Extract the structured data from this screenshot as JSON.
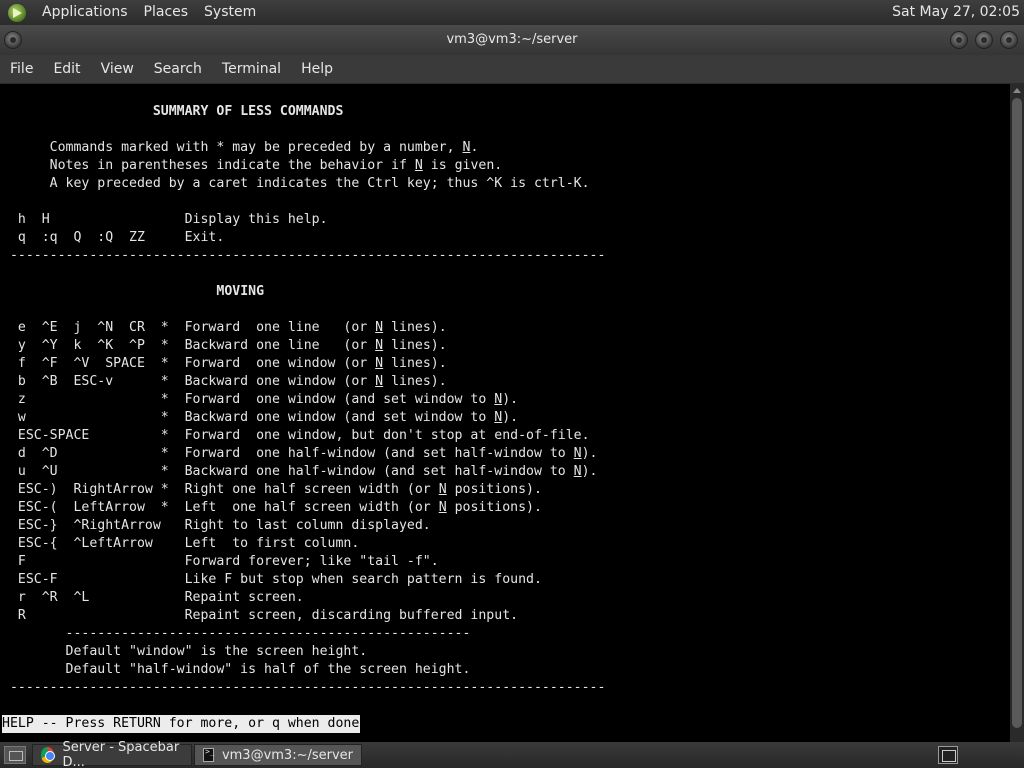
{
  "top_panel": {
    "menus": [
      "Applications",
      "Places",
      "System"
    ],
    "clock": "Sat May 27, 02:05"
  },
  "window": {
    "title": "vm3@vm3:~/server",
    "menubar": [
      "File",
      "Edit",
      "View",
      "Search",
      "Terminal",
      "Help"
    ]
  },
  "terminal": {
    "lines": [
      [
        {
          "t": "                   "
        },
        {
          "t": "SUMMARY OF LESS COMMANDS",
          "b": true
        }
      ],
      [],
      [
        {
          "t": "      Commands marked with * may be preceded by a number, "
        },
        {
          "t": "N",
          "u": true
        },
        {
          "t": "."
        }
      ],
      [
        {
          "t": "      Notes in parentheses indicate the behavior if "
        },
        {
          "t": "N",
          "u": true
        },
        {
          "t": " is given."
        }
      ],
      [
        {
          "t": "      A key preceded by a caret indicates the Ctrl key; thus ^K is ctrl-K."
        }
      ],
      [],
      [
        {
          "t": "  h  H                 Display this help."
        }
      ],
      [
        {
          "t": "  q  :q  Q  :Q  ZZ     Exit."
        }
      ],
      [
        {
          "t": " ---------------------------------------------------------------------------"
        }
      ],
      [],
      [
        {
          "t": "                           "
        },
        {
          "t": "MOVING",
          "b": true
        }
      ],
      [],
      [
        {
          "t": "  e  ^E  j  ^N  CR  *  Forward  one line   (or "
        },
        {
          "t": "N",
          "u": true
        },
        {
          "t": " lines)."
        }
      ],
      [
        {
          "t": "  y  ^Y  k  ^K  ^P  *  Backward one line   (or "
        },
        {
          "t": "N",
          "u": true
        },
        {
          "t": " lines)."
        }
      ],
      [
        {
          "t": "  f  ^F  ^V  SPACE  *  Forward  one window (or "
        },
        {
          "t": "N",
          "u": true
        },
        {
          "t": " lines)."
        }
      ],
      [
        {
          "t": "  b  ^B  ESC-v      *  Backward one window (or "
        },
        {
          "t": "N",
          "u": true
        },
        {
          "t": " lines)."
        }
      ],
      [
        {
          "t": "  z                 *  Forward  one window (and set window to "
        },
        {
          "t": "N",
          "u": true
        },
        {
          "t": ")."
        }
      ],
      [
        {
          "t": "  w                 *  Backward one window (and set window to "
        },
        {
          "t": "N",
          "u": true
        },
        {
          "t": ")."
        }
      ],
      [
        {
          "t": "  ESC-SPACE         *  Forward  one window, but don't stop at end-of-file."
        }
      ],
      [
        {
          "t": "  d  ^D             *  Forward  one half-window (and set half-window to "
        },
        {
          "t": "N",
          "u": true
        },
        {
          "t": ")."
        }
      ],
      [
        {
          "t": "  u  ^U             *  Backward one half-window (and set half-window to "
        },
        {
          "t": "N",
          "u": true
        },
        {
          "t": ")."
        }
      ],
      [
        {
          "t": "  ESC-)  RightArrow *  Right one half screen width (or "
        },
        {
          "t": "N",
          "u": true
        },
        {
          "t": " positions)."
        }
      ],
      [
        {
          "t": "  ESC-(  LeftArrow  *  Left  one half screen width (or "
        },
        {
          "t": "N",
          "u": true
        },
        {
          "t": " positions)."
        }
      ],
      [
        {
          "t": "  ESC-}  ^RightArrow   Right to last column displayed."
        }
      ],
      [
        {
          "t": "  ESC-{  ^LeftArrow    Left  to first column."
        }
      ],
      [
        {
          "t": "  F                    Forward forever; like \"tail -f\"."
        }
      ],
      [
        {
          "t": "  ESC-F                Like F but stop when search pattern is found."
        }
      ],
      [
        {
          "t": "  r  ^R  ^L            Repaint screen."
        }
      ],
      [
        {
          "t": "  R                    Repaint screen, discarding buffered input."
        }
      ],
      [
        {
          "t": "        ---------------------------------------------------"
        }
      ],
      [
        {
          "t": "        Default \"window\" is the screen height."
        }
      ],
      [
        {
          "t": "        Default \"half-window\" is half of the screen height."
        }
      ],
      [
        {
          "t": " ---------------------------------------------------------------------------"
        }
      ]
    ],
    "status": "HELP -- Press RETURN for more, or q when done"
  },
  "taskbar": {
    "tasks": [
      {
        "label": "Server - Spacebar D...",
        "icon": "chrome-icon"
      },
      {
        "label": "vm3@vm3:~/server",
        "icon": "terminal-icon"
      }
    ]
  }
}
